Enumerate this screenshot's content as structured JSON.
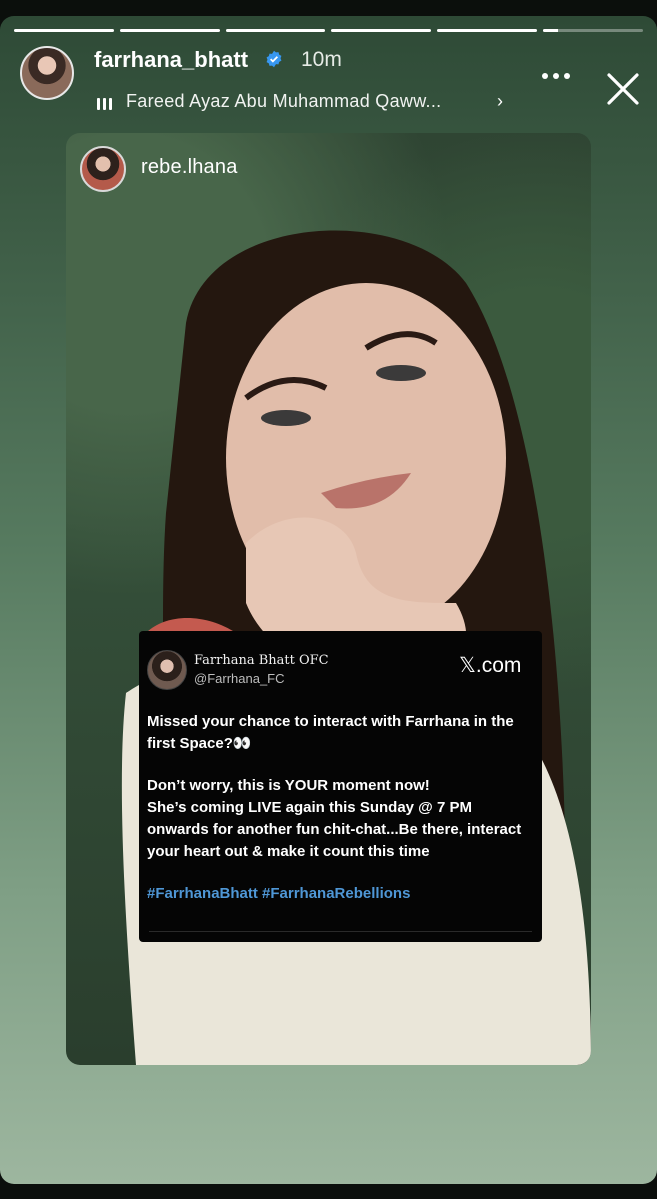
{
  "story": {
    "progress_segments": [
      1,
      1,
      1,
      1,
      1,
      0.15
    ]
  },
  "header": {
    "username": "farrhana_bhatt",
    "time": "10m",
    "song": "Fareed Ayaz Abu Muhammad Qaww...",
    "chevron": "›"
  },
  "repost": {
    "username": "rebe.lhana"
  },
  "tweet": {
    "name": "Farrhana Bhatt OFC",
    "handle": "@Farrhana_FC",
    "site": "𝕏.com",
    "para1": "Missed your chance to interact with Farrhana in the first Space?👀",
    "para2a": "Don’t worry, this is YOUR moment now!",
    "para2b": "She’s coming LIVE again this Sunday @ 7 PM onwards for another fun chit-chat...Be there, interact your heart out & make it count this time",
    "hashtags": "#FarrhanaBhatt #FarrhanaRebellions"
  },
  "colors": {
    "verified": "#3797f0",
    "hashtag": "#4f97d6",
    "story_bg_top": "#2e4a36",
    "story_bg_bottom": "#9db69f"
  },
  "icons": [
    "verified-badge-icon",
    "music-bars-icon",
    "more-icon",
    "close-icon"
  ]
}
